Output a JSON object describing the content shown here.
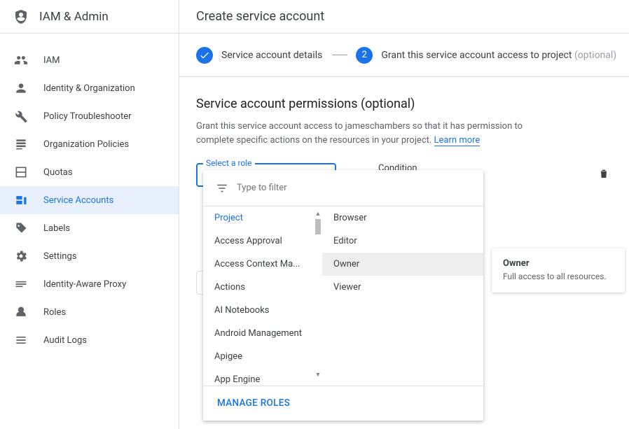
{
  "sidebar": {
    "title": "IAM & Admin",
    "items": [
      {
        "label": "IAM",
        "icon": "people-icon"
      },
      {
        "label": "Identity & Organization",
        "icon": "person-icon"
      },
      {
        "label": "Policy Troubleshooter",
        "icon": "wrench-icon"
      },
      {
        "label": "Organization Policies",
        "icon": "list-icon"
      },
      {
        "label": "Quotas",
        "icon": "quota-icon"
      },
      {
        "label": "Service Accounts",
        "icon": "service-account-icon"
      },
      {
        "label": "Labels",
        "icon": "tag-icon"
      },
      {
        "label": "Settings",
        "icon": "gear-icon"
      },
      {
        "label": "Identity-Aware Proxy",
        "icon": "proxy-icon"
      },
      {
        "label": "Roles",
        "icon": "roles-icon"
      },
      {
        "label": "Audit Logs",
        "icon": "audit-icon"
      }
    ],
    "active_index": 5
  },
  "header": {
    "title": "Create service account"
  },
  "stepper": {
    "step1": {
      "label": "Service account details",
      "state": "done"
    },
    "step2": {
      "number": "2",
      "label": "Grant this service account access to project",
      "optional": "(optional)"
    }
  },
  "section": {
    "title": "Service account permissions (optional)",
    "desc_prefix": "Grant this service account access to jameschambers so that it has permission to complete specific actions on the resources in your project. ",
    "learn_more": "Learn more"
  },
  "role_picker": {
    "float_label": "Select a role",
    "condition_label": "Condition",
    "filter_placeholder": "Type to filter",
    "manage_roles_label": "MANAGE ROLES",
    "categories": [
      "Project",
      "Access Approval",
      "Access Context Ma...",
      "Actions",
      "AI Notebooks",
      "Android Management",
      "Apigee",
      "App Engine"
    ],
    "selected_category_index": 0,
    "roles": [
      "Browser",
      "Editor",
      "Owner",
      "Viewer"
    ],
    "hovered_role_index": 2
  },
  "tooltip": {
    "title": "Owner",
    "desc": "Full access to all resources."
  }
}
